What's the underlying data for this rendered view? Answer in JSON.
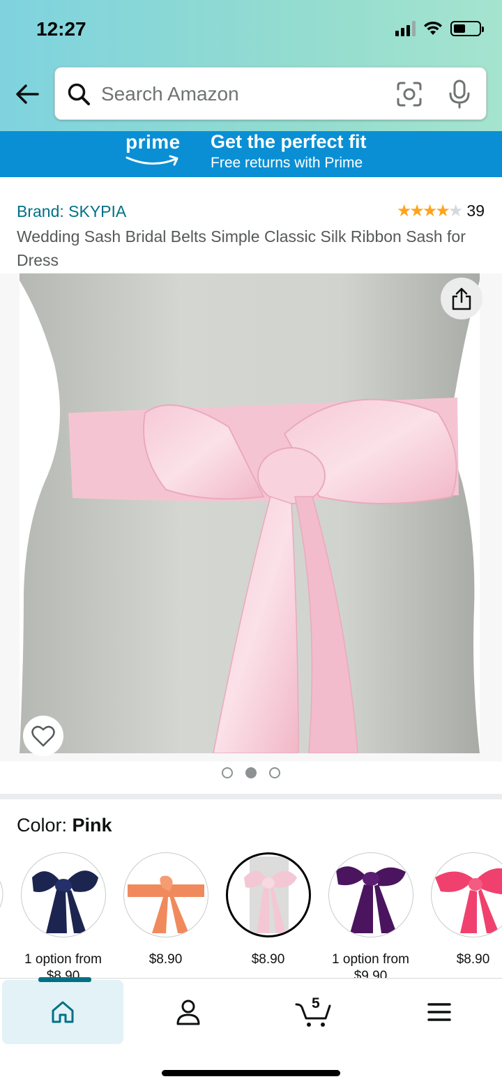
{
  "status_bar": {
    "time": "12:27"
  },
  "search": {
    "placeholder": "Search Amazon"
  },
  "prime_banner": {
    "logo_text": "prime",
    "title": "Get the perfect fit",
    "subtitle": "Free returns with Prime"
  },
  "product": {
    "brand": "Brand: SKYPIA",
    "rating_stars": 4,
    "rating_count": "39",
    "title": "Wedding Sash Bridal Belts Simple Classic Silk Ribbon Sash for Dress",
    "image_count": 3,
    "image_active_index": 1
  },
  "color": {
    "label": "Color: ",
    "selected": "Pink",
    "swatches": [
      {
        "color": "#1c2550",
        "price": "1 option from $8.90"
      },
      {
        "color": "#f08a5d",
        "price": "$8.90"
      },
      {
        "color": "#f4c7d4",
        "price": "$8.90"
      },
      {
        "color": "#4a155e",
        "price": "1 option from $9.90"
      },
      {
        "color": "#f0416e",
        "price": "$8.90"
      }
    ]
  },
  "nav": {
    "cart_count": "5"
  },
  "colors": {
    "accent": "#007185",
    "prime_blue": "#0a8fd4",
    "star": "#ffa41c"
  }
}
